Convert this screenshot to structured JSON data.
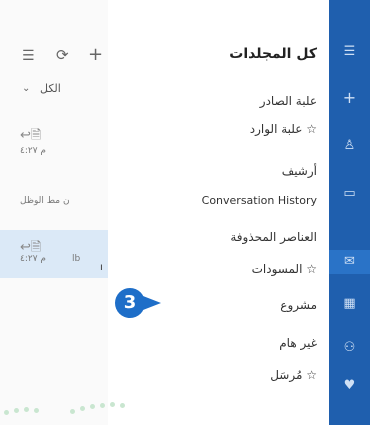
{
  "left_pane": {
    "filter_label": "الكل",
    "messages": [
      {
        "time": "م ٤:٢٧",
        "selected": false
      },
      {
        "preview": "ن مط الوظل",
        "selected": false
      },
      {
        "time": "م ٤:٢٧",
        "selected": true,
        "extra": "lb"
      }
    ]
  },
  "folders": {
    "title": "كل المجلدات",
    "items": [
      {
        "label": "علبة الصادر"
      },
      {
        "label": "علبة الوارد ☆"
      },
      {
        "label": "أرشيف"
      },
      {
        "label": "Conversation History"
      },
      {
        "label": "العناصر المحذوفة"
      },
      {
        "label": "المسودات ☆"
      },
      {
        "label": "مشروع"
      },
      {
        "label": "غير هام"
      },
      {
        "label": "مُرسَل ☆"
      }
    ]
  },
  "callout": {
    "number": "3"
  },
  "colors": {
    "rail": "#1f5fae",
    "badge": "#1e6ec8"
  }
}
